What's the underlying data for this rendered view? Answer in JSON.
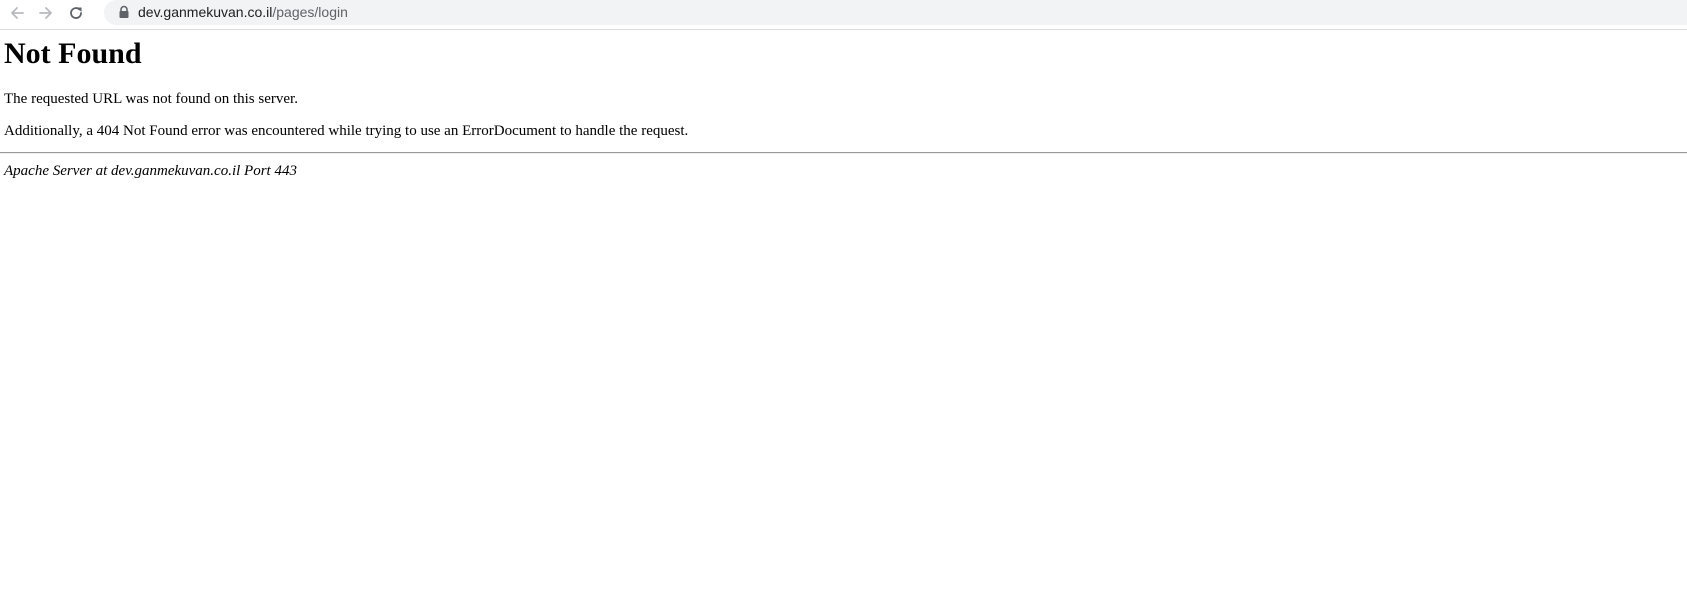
{
  "browser": {
    "back_icon": "arrow-left-icon",
    "forward_icon": "arrow-right-icon",
    "reload_icon": "reload-icon",
    "lock_icon": "lock-icon",
    "url_domain": "dev.ganmekuvan.co.il",
    "url_path": "/pages/login"
  },
  "page": {
    "title": "Not Found",
    "message": "The requested URL was not found on this server.",
    "additional": "Additionally, a 404 Not Found error was encountered while trying to use an ErrorDocument to handle the request.",
    "server_signature": "Apache Server at dev.ganmekuvan.co.il Port 443"
  }
}
